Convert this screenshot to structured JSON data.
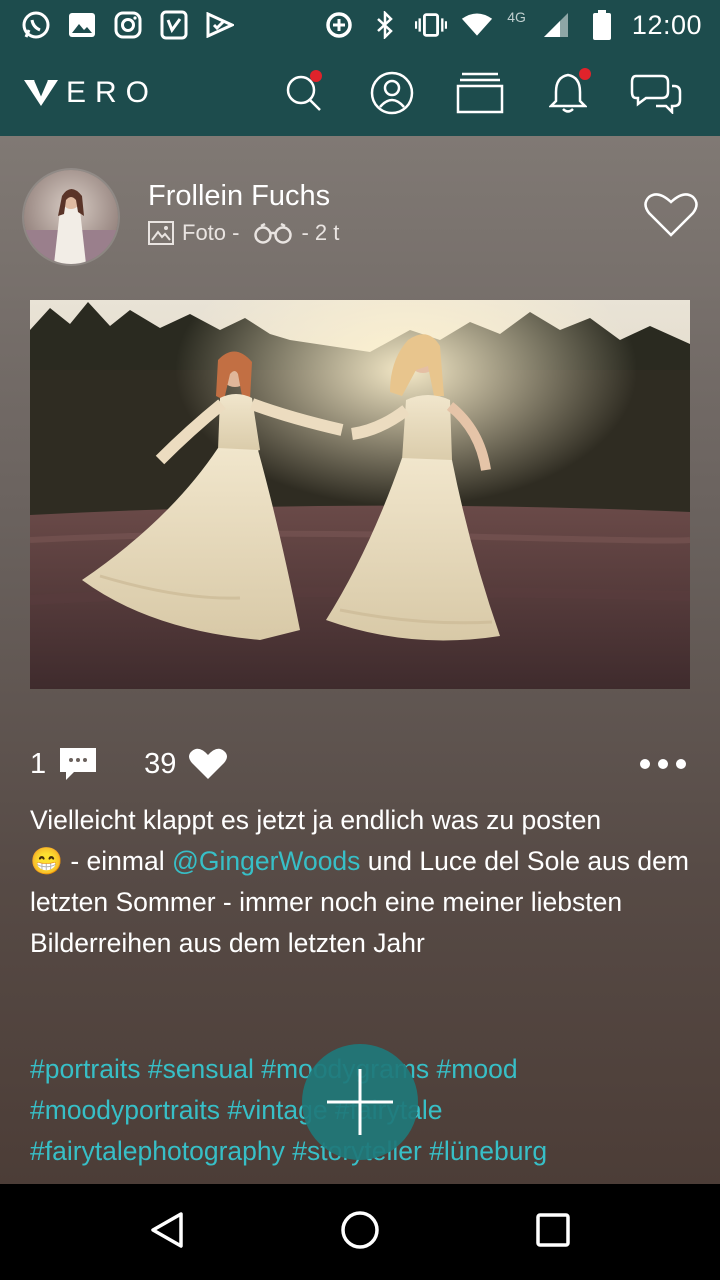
{
  "status_bar": {
    "time": "12:00",
    "network_label": "4G",
    "icons": [
      "whatsapp-icon",
      "gallery-icon",
      "instagram-icon",
      "tasks-icon",
      "check-flag-icon",
      "data-saver-icon",
      "bluetooth-icon",
      "vibrate-icon",
      "wifi-icon",
      "signal-icon",
      "battery-icon"
    ]
  },
  "app_bar": {
    "logo": "ERO",
    "nav": [
      "search-icon",
      "profile-icon",
      "collections-icon",
      "notifications-icon",
      "messages-icon"
    ],
    "notification_color": "#e0232b",
    "brand_color": "#1d4c4d"
  },
  "post": {
    "user_name": "Frollein Fuchs",
    "type_label": "Foto -",
    "time_label": "- 2 t",
    "comments_count": "1",
    "likes_count": "39",
    "caption_part1": "Vielleicht klappt es jetzt ja endlich was zu posten",
    "caption_emoji": "😁",
    "caption_part2": " - einmal ",
    "mention": "@GingerWoods",
    "caption_part3": " und Luce del Sole aus dem letzten Sommer - immer noch eine meiner liebsten Bilderreihen aus dem letzten Jahr",
    "hashtags": "#portraits #sensual #moodygrams #mood #moodyportraits #vintage #fairytale #fairytalephotography #storyteller #lüneburg",
    "accent_color": "#37bfc7"
  }
}
